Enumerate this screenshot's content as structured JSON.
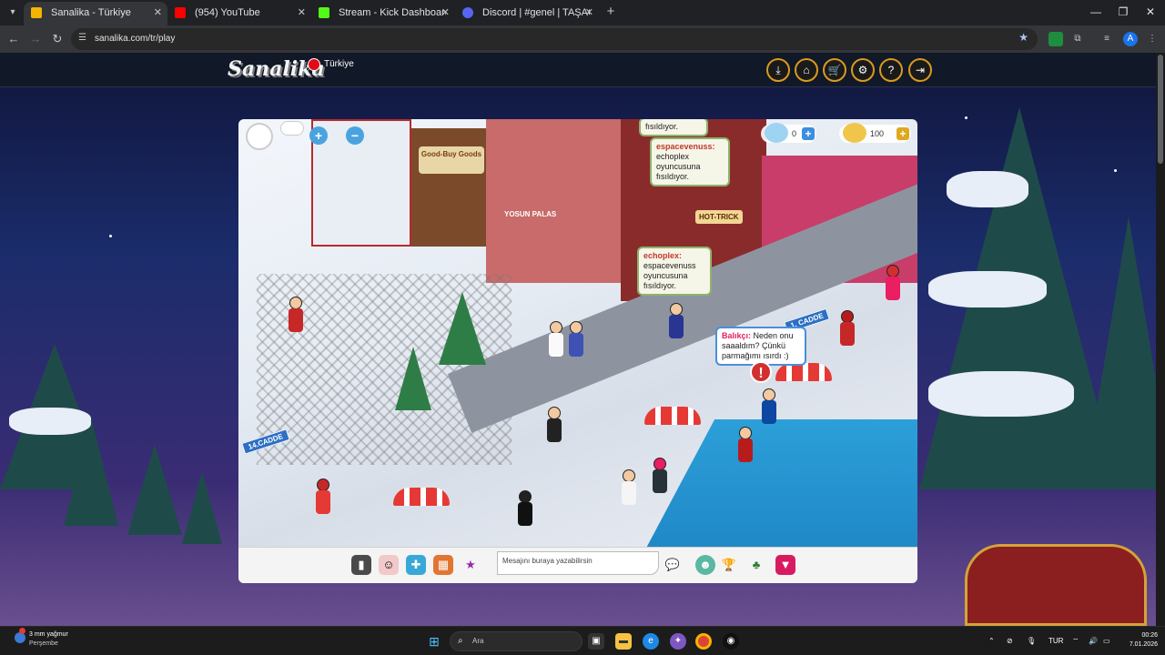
{
  "browser": {
    "tabs": [
      {
        "label": "Sanalika - Türkiye",
        "favicon_color": "#f4b400",
        "active": true
      },
      {
        "label": "(954) YouTube",
        "favicon_color": "#ff0000",
        "active": false
      },
      {
        "label": "Stream - Kick Dashboard",
        "favicon_color": "#53fc18",
        "active": false
      },
      {
        "label": "Discord | #genel | TAŞACAK",
        "favicon_color": "#5865f2",
        "active": false
      }
    ],
    "url": "sanalika.com/tr/play"
  },
  "site": {
    "logo": "Sanalika",
    "region": "Türkiye",
    "header_icons": [
      "download-icon",
      "home-icon",
      "cart-icon",
      "settings-icon",
      "help-icon",
      "logout-icon"
    ]
  },
  "game": {
    "diamonds": "0",
    "gold": "100",
    "signs": {
      "good_buy": "Good-Buy Goods",
      "hot_trick": "HOT-TRICK",
      "street_14": "14.CADDE",
      "street_1": "1. CADDE",
      "yosun": "YOSUN PALAS"
    },
    "bubbles": [
      {
        "partial": "fısıldıyor."
      },
      {
        "name": "espacevenuss:",
        "text": "echoplex oyuncusuna fısıldıyor."
      },
      {
        "name": "echoplex:",
        "text": "espacevenuss oyuncusuna fısıldıyor."
      },
      {
        "name": "Balıkçı:",
        "text": "Neden onu saaaldım? Çünkü parmağımı ısırdı :)"
      }
    ],
    "chat_placeholder": "Mesajını buraya yazabilirsin"
  },
  "taskbar": {
    "weather_temp": "3 mm yağmur",
    "weather_day": "Perşembe",
    "search_placeholder": "Ara",
    "lang": "TUR",
    "time": "00:26",
    "date": "7.01.2026"
  },
  "colors": {
    "accent_gold": "#d99a1f",
    "water": "#1a7fc0",
    "browser_bg": "#202124"
  }
}
